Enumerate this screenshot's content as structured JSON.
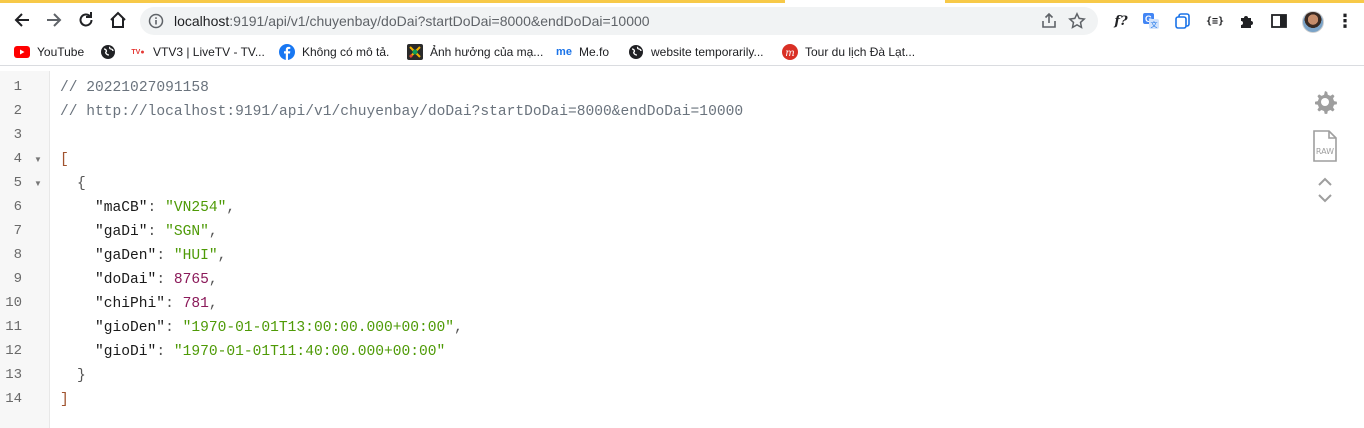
{
  "browser": {
    "url_host": "localhost",
    "url_rest": ":9191/api/v1/chuyenbay/doDai?startDoDai=8000&endDoDai=10000",
    "extensions": [
      {
        "name": "formula-extension",
        "glyph": "f?"
      },
      {
        "name": "translate-extension",
        "glyph": "G"
      },
      {
        "name": "copy-extension",
        "glyph": "⧉"
      },
      {
        "name": "json-extension",
        "glyph": "{≡}"
      },
      {
        "name": "puzzle-extension",
        "glyph": "✚"
      },
      {
        "name": "sidepanel-extension",
        "glyph": "▮"
      }
    ]
  },
  "bookmarks": [
    {
      "label": "YouTube",
      "icon": "youtube-icon",
      "color": "#ff0000"
    },
    {
      "label": "",
      "icon": "globe-icon",
      "color": "#202124"
    },
    {
      "label": "VTV3 | LiveTV - TV...",
      "icon": "tv-icon",
      "color": "#e53935"
    },
    {
      "label": "Không có mô tả.",
      "icon": "facebook-icon",
      "color": "#1877f2"
    },
    {
      "label": "Ảnh hưởng của mạ...",
      "icon": "colorful-icon",
      "color": "#2a2a2a"
    },
    {
      "label": "Me.fo",
      "icon": "me-icon",
      "color": "#1a73e8"
    },
    {
      "label": "website temporarily...",
      "icon": "globe-icon",
      "color": "#202124"
    },
    {
      "label": "Tour du lịch Đà Lạt...",
      "icon": "tour-icon",
      "color": "#d93025"
    }
  ],
  "viewer": {
    "comment_timestamp": "// 20221027091158",
    "comment_url": "// http://localhost:9191/api/v1/chuyenbay/doDai?startDoDai=8000&endDoDai=10000",
    "line_numbers": [
      "1",
      "2",
      "3",
      "4",
      "5",
      "6",
      "7",
      "8",
      "9",
      "10",
      "11",
      "12",
      "13",
      "14"
    ],
    "open_bracket": "[",
    "close_bracket": "]",
    "open_brace": "{",
    "close_brace": "}",
    "fields": [
      {
        "key": "\"maCB\"",
        "value": "\"VN254\"",
        "type": "string",
        "comma": ","
      },
      {
        "key": "\"gaDi\"",
        "value": "\"SGN\"",
        "type": "string",
        "comma": ","
      },
      {
        "key": "\"gaDen\"",
        "value": "\"HUI\"",
        "type": "string",
        "comma": ","
      },
      {
        "key": "\"doDai\"",
        "value": "8765",
        "type": "number",
        "comma": ","
      },
      {
        "key": "\"chiPhi\"",
        "value": "781",
        "type": "number",
        "comma": ","
      },
      {
        "key": "\"gioDen\"",
        "value": "\"1970-01-01T13:00:00.000+00:00\"",
        "type": "string",
        "comma": ","
      },
      {
        "key": "\"gioDi\"",
        "value": "\"1970-01-01T11:40:00.000+00:00\"",
        "type": "string",
        "comma": ""
      }
    ],
    "raw_label": "RAW"
  }
}
